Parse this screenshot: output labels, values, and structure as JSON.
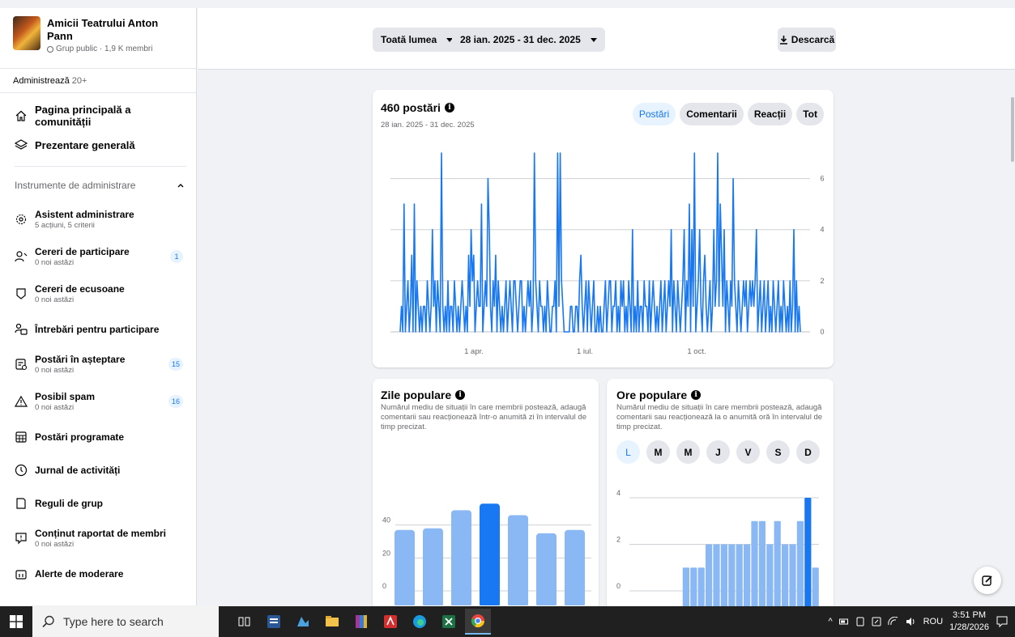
{
  "sidebar": {
    "group_name": "Amicii Teatrului Anton Pann",
    "group_meta": "Grup public · 1,9 K membri",
    "admin_label": "Administrează",
    "admin_count": "20+",
    "nav": [
      {
        "label": "Pagina principală a comunității",
        "icon": "home-icon"
      },
      {
        "label": "Prezentare generală",
        "icon": "layers-icon"
      }
    ],
    "tools_header": "Instrumente de administrare",
    "tools": [
      {
        "label": "Asistent administrare",
        "sub": "5 acțiuni, 5 criterii",
        "icon": "gear-icon",
        "badge": ""
      },
      {
        "label": "Cereri de participare",
        "sub": "0 noi astăzi",
        "icon": "user-add-icon",
        "badge": "1"
      },
      {
        "label": "Cereri de ecusoane",
        "sub": "0 noi astăzi",
        "icon": "shield-icon",
        "badge": ""
      },
      {
        "label": "Întrebări pentru participare",
        "sub": "",
        "icon": "question-people-icon",
        "badge": ""
      },
      {
        "label": "Postări în așteptare",
        "sub": "0 noi astăzi",
        "icon": "pending-posts-icon",
        "badge": "15"
      },
      {
        "label": "Posibil spam",
        "sub": "0 noi astăzi",
        "icon": "warning-icon",
        "badge": "16"
      },
      {
        "label": "Postări programate",
        "sub": "",
        "icon": "calendar-icon",
        "badge": ""
      },
      {
        "label": "Jurnal de activități",
        "sub": "",
        "icon": "clock-icon",
        "badge": ""
      },
      {
        "label": "Reguli de grup",
        "sub": "",
        "icon": "rules-icon",
        "badge": ""
      },
      {
        "label": "Conținut raportat de membri",
        "sub": "0 noi astăzi",
        "icon": "report-icon",
        "badge": ""
      },
      {
        "label": "Alerte de moderare",
        "sub": "",
        "icon": "alert-icon",
        "badge": ""
      }
    ]
  },
  "topbar": {
    "audience": "Toată lumea",
    "date_range": "28 ian. 2025 - 31 dec. 2025",
    "download": "Descarcă"
  },
  "posts_card": {
    "title": "460 postări",
    "date_range": "28 ian. 2025 - 31 dec. 2025",
    "tabs": [
      "Postări",
      "Comentarii",
      "Reacții",
      "Tot"
    ],
    "active_tab": "Postări"
  },
  "days_card": {
    "title": "Zile populare",
    "desc": "Numărul mediu de situații în care membrii postează, adaugă comentarii sau reacționează într-o anumită zi în intervalul de timp precizat."
  },
  "hours_card": {
    "title": "Ore populare",
    "desc": "Numărul mediu de situații în care membrii postează, adaugă comentarii sau reacționează la o anumită oră în intervalul de timp precizat.",
    "days": [
      "L",
      "M",
      "M",
      "J",
      "V",
      "S",
      "D"
    ],
    "active_day": "L"
  },
  "taskbar": {
    "search_placeholder": "Type here to search",
    "lang": "ROU",
    "time": "3:51 PM",
    "date": "1/28/2026"
  },
  "colors": {
    "accent": "#1877f2",
    "bar_light": "#8ab8f5",
    "bar_dark": "#1877f2"
  },
  "chart_data": [
    {
      "type": "line",
      "title": "460 postări",
      "xlabel": "",
      "ylabel": "",
      "x_ticks": [
        "1 apr.",
        "1 iul.",
        "1 oct."
      ],
      "y_ticks": [
        0,
        2,
        4,
        6
      ],
      "ylim": [
        0,
        7
      ],
      "grid": true,
      "series": [
        {
          "values": [
            0,
            1,
            0,
            5,
            0,
            1,
            2,
            0,
            1,
            3,
            0,
            5,
            0,
            2,
            1,
            0,
            1,
            0,
            1,
            1,
            0,
            2,
            1,
            0,
            1,
            4,
            1,
            2,
            0,
            2,
            1,
            0,
            7,
            1,
            0,
            1,
            0,
            2,
            0,
            1,
            1,
            0,
            2,
            1,
            0,
            1,
            0,
            1,
            2,
            1,
            0,
            1,
            0,
            3,
            1,
            4,
            2,
            3,
            0,
            1,
            2,
            1,
            1,
            5,
            0,
            1,
            2,
            1,
            6,
            4,
            1,
            0,
            2,
            1,
            3,
            0,
            2,
            1,
            0,
            1,
            0,
            1,
            2,
            0,
            1,
            2,
            1,
            0,
            2,
            2,
            1,
            0,
            1,
            2,
            2,
            0,
            1,
            0,
            1,
            2,
            1,
            2,
            0,
            1,
            7,
            2,
            1,
            0,
            2,
            1,
            1,
            0,
            1,
            0,
            2,
            1,
            0,
            0,
            1,
            1,
            2,
            0,
            7,
            1,
            7,
            2,
            1,
            0,
            0,
            0,
            0,
            0,
            1,
            1,
            0,
            0,
            1,
            1,
            0,
            2,
            3,
            1,
            0,
            1,
            2,
            0,
            2,
            1,
            0,
            1,
            2,
            0,
            0,
            1,
            0,
            1,
            0,
            0,
            1,
            2,
            0,
            1,
            2,
            2,
            0,
            1,
            1,
            2,
            0,
            1,
            0,
            2,
            1,
            2,
            0,
            1,
            0,
            2,
            1,
            0,
            4,
            0,
            1,
            0,
            2,
            0,
            1,
            1,
            0,
            2,
            1,
            1,
            0,
            2,
            0,
            1,
            2,
            1,
            0,
            1,
            0,
            1,
            2,
            0,
            1,
            2,
            0,
            1,
            2,
            1,
            4,
            0,
            2,
            1,
            0,
            2,
            1,
            0,
            1,
            2,
            4,
            0,
            2,
            1,
            5,
            0,
            4,
            1,
            7,
            0,
            1,
            2,
            4,
            1,
            0,
            2,
            3,
            1,
            0,
            1,
            2,
            0,
            1,
            4,
            1,
            2,
            7,
            1,
            5,
            3,
            1,
            4,
            0,
            2,
            1,
            0,
            2,
            1,
            6,
            2,
            1,
            0,
            2,
            1,
            0,
            1,
            2,
            1,
            2,
            0,
            1,
            2,
            1,
            2,
            1,
            2,
            4,
            0,
            1,
            2,
            0,
            1,
            2,
            0,
            1,
            2,
            0,
            1,
            0,
            2,
            1,
            0,
            1,
            2,
            0,
            1,
            0,
            2,
            1,
            0,
            1,
            0,
            2,
            0,
            1,
            4,
            0,
            2,
            0,
            1,
            0
          ]
        }
      ]
    },
    {
      "type": "bar",
      "title": "Zile populare",
      "categories": [
        "L",
        "M",
        "M",
        "J",
        "V",
        "S",
        "D"
      ],
      "values": [
        37,
        38,
        49,
        53,
        46,
        35,
        37
      ],
      "highlight_index": 3,
      "y_ticks": [
        0,
        20,
        40
      ],
      "ylim": [
        0,
        60
      ],
      "grid": true
    },
    {
      "type": "bar",
      "title": "Ore populare",
      "categories": [
        "0",
        "1",
        "2",
        "3",
        "4",
        "5",
        "6",
        "7",
        "8",
        "9",
        "10",
        "11",
        "12",
        "13",
        "14",
        "15",
        "16",
        "17",
        "18",
        "19",
        "20",
        "21",
        "22",
        "23"
      ],
      "values": [
        0,
        0,
        0,
        0,
        0,
        0,
        0,
        1,
        1,
        1,
        2,
        2,
        2,
        2,
        2,
        2,
        3,
        3,
        2,
        3,
        2,
        2,
        3,
        4,
        1
      ],
      "highlight_index": 23,
      "y_ticks": [
        0,
        2,
        4
      ],
      "ylim": [
        0,
        4
      ],
      "grid": true
    }
  ]
}
